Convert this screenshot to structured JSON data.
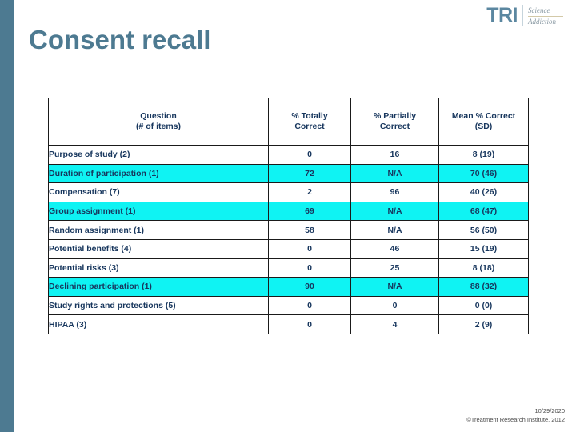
{
  "slide": {
    "title": "Consent recall",
    "accent_color": "#4d7a91",
    "highlight_color": "#0ff3f3",
    "text_color": "#17365d"
  },
  "logo": {
    "mark": "TRI",
    "tagline_line1": "Science",
    "tagline_line2": "Addiction"
  },
  "table": {
    "headers": {
      "question_line1": "Question",
      "question_line2": "(# of items)",
      "totally_line1": "% Totally",
      "totally_line2": "Correct",
      "partially_line1": "% Partially",
      "partially_line2": "Correct",
      "mean_line1": "Mean % Correct",
      "mean_line2": "(SD)"
    },
    "rows": [
      {
        "question": "Purpose of study (2)",
        "totally": "0",
        "partially": "16",
        "mean": "8 (19)",
        "highlight": false
      },
      {
        "question": "Duration of participation (1)",
        "totally": "72",
        "partially": "N/A",
        "mean": "70 (46)",
        "highlight": true
      },
      {
        "question": "Compensation (7)",
        "totally": "2",
        "partially": "96",
        "mean": "40 (26)",
        "highlight": false
      },
      {
        "question": "Group assignment (1)",
        "totally": "69",
        "partially": "N/A",
        "mean": "68 (47)",
        "highlight": true
      },
      {
        "question": "Random assignment (1)",
        "totally": "58",
        "partially": "N/A",
        "mean": "56 (50)",
        "highlight": false
      },
      {
        "question": "Potential benefits (4)",
        "totally": "0",
        "partially": "46",
        "mean": "15 (19)",
        "highlight": false
      },
      {
        "question": "Potential risks (3)",
        "totally": "0",
        "partially": "25",
        "mean": "8 (18)",
        "highlight": false
      },
      {
        "question": "Declining participation (1)",
        "totally": "90",
        "partially": "N/A",
        "mean": "88 (32)",
        "highlight": true
      },
      {
        "question": "Study rights and protections  (5)",
        "totally": "0",
        "partially": "0",
        "mean": "0 (0)",
        "highlight": false
      },
      {
        "question": "HIPAA (3)",
        "totally": "0",
        "partially": "4",
        "mean": "2 (9)",
        "highlight": false
      }
    ]
  },
  "footer": {
    "date": "10/29/2020",
    "copyright": "©Treatment Research Institute, 2012"
  }
}
